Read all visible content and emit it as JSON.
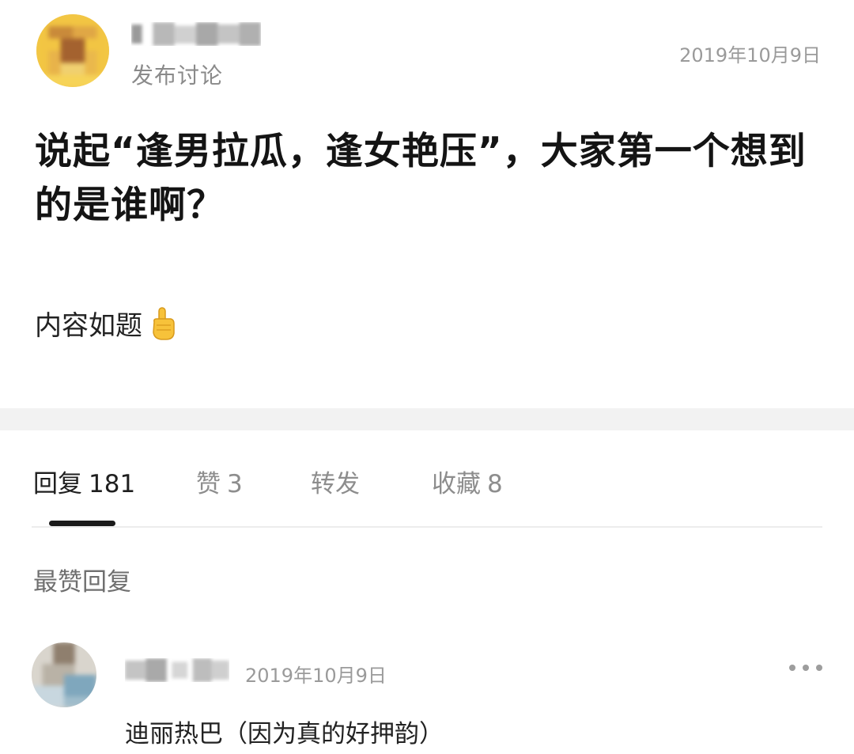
{
  "post": {
    "action": "发布讨论",
    "date": "2019年10月9日",
    "title": "说起“逢男拉瓜，逢女艳压”，大家第一个想到的是谁啊？",
    "body": "内容如题",
    "emoji": "pointing-up-icon"
  },
  "tabs": [
    {
      "label": "回复",
      "count": "181",
      "active": true
    },
    {
      "label": "赞",
      "count": "3",
      "active": false
    },
    {
      "label": "转发",
      "count": "",
      "active": false
    },
    {
      "label": "收藏",
      "count": "8",
      "active": false
    }
  ],
  "hot_replies": {
    "heading": "最赞回复",
    "items": [
      {
        "date": "2019年10月9日",
        "text": "迪丽热巴（因为真的好押韵）"
      }
    ]
  },
  "colors": {
    "accent": "#1a1a1a",
    "muted_text": "#8d8d8d",
    "separator": "#f2f2f2"
  }
}
